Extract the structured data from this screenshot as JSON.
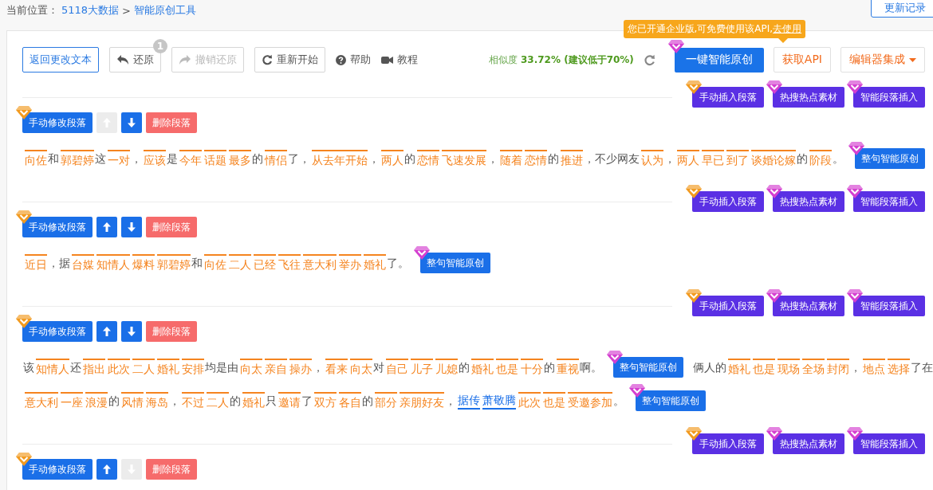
{
  "breadcrumb": {
    "label": "当前位置：",
    "links": [
      "5118大数据",
      "智能原创工具"
    ],
    "separator": ">"
  },
  "update_log_button": "更新记录",
  "toolbar": {
    "back_button": "返回更改文本",
    "undo": {
      "label": "还原",
      "badge": "1",
      "disabled": false
    },
    "redo": {
      "label": "撤销还原",
      "disabled": true
    },
    "restart": "重新开始",
    "help": "帮助",
    "tutorial": "教程",
    "similarity": {
      "label": "相似度",
      "value": "33.72% (建议低于70%)"
    },
    "rewrite_all": "一键智能原创",
    "get_api": "获取API",
    "editor_integration": "编辑器集成",
    "tooltip": {
      "text": "您已开通企业版,可免费使用该API,",
      "link": "去使用"
    }
  },
  "paragraphs": [
    {
      "insert_buttons": [
        {
          "label": "手动插入段落",
          "color": "#f29a1f"
        },
        {
          "label": "热搜热点素材",
          "color": "#d43fd0"
        },
        {
          "label": "智能段落插入",
          "color": "#d43fd0"
        }
      ],
      "edit_button": "手动修改段落",
      "move_up_disabled": true,
      "move_down_disabled": false,
      "delete_button": "删除段落",
      "lines": [
        [
          {
            "kind": "word",
            "text": "向佐"
          },
          {
            "kind": "plain",
            "text": "和"
          },
          {
            "kind": "word",
            "text": "郭碧婷"
          },
          {
            "kind": "plain",
            "text": "这"
          },
          {
            "kind": "word",
            "text": "一对"
          },
          {
            "kind": "plain",
            "text": "，"
          },
          {
            "kind": "word",
            "text": "应该"
          },
          {
            "kind": "plain",
            "text": "是"
          },
          {
            "kind": "word",
            "text": "今年"
          },
          {
            "kind": "word",
            "text": "话题"
          },
          {
            "kind": "word",
            "text": "最多"
          },
          {
            "kind": "plain",
            "text": "的"
          },
          {
            "kind": "word",
            "text": "情侣"
          },
          {
            "kind": "plain",
            "text": "了，"
          },
          {
            "kind": "word",
            "text": "从去年开始"
          },
          {
            "kind": "plain",
            "text": "，"
          },
          {
            "kind": "word",
            "text": "两人"
          },
          {
            "kind": "plain",
            "text": "的"
          },
          {
            "kind": "word",
            "text": "恋情"
          },
          {
            "kind": "word",
            "text": "飞速发展"
          },
          {
            "kind": "plain",
            "text": "，"
          },
          {
            "kind": "word",
            "text": "随着"
          },
          {
            "kind": "word",
            "text": "恋情"
          },
          {
            "kind": "plain",
            "text": "的"
          },
          {
            "kind": "word",
            "text": "推进"
          },
          {
            "kind": "plain",
            "text": "，不少网友"
          },
          {
            "kind": "word",
            "text": "认为"
          },
          {
            "kind": "plain",
            "text": "，"
          },
          {
            "kind": "word",
            "text": "两人"
          },
          {
            "kind": "word",
            "text": "早已"
          },
          {
            "kind": "word",
            "text": "到了"
          },
          {
            "kind": "word",
            "text": "谈婚论嫁"
          },
          {
            "kind": "plain",
            "text": "的"
          },
          {
            "kind": "word",
            "text": "阶段"
          },
          {
            "kind": "plain",
            "text": "。"
          },
          {
            "kind": "rewrite",
            "text": "整句智能原创"
          }
        ]
      ]
    },
    {
      "insert_buttons": [
        {
          "label": "手动插入段落",
          "color": "#f29a1f"
        },
        {
          "label": "热搜热点素材",
          "color": "#d43fd0"
        },
        {
          "label": "智能段落插入",
          "color": "#d43fd0"
        }
      ],
      "edit_button": "手动修改段落",
      "move_up_disabled": false,
      "move_down_disabled": false,
      "delete_button": "删除段落",
      "lines": [
        [
          {
            "kind": "word",
            "text": "近日"
          },
          {
            "kind": "plain",
            "text": "，据"
          },
          {
            "kind": "word",
            "text": "台媒"
          },
          {
            "kind": "word",
            "text": "知情人"
          },
          {
            "kind": "word",
            "text": "爆料"
          },
          {
            "kind": "word",
            "text": "郭碧婷"
          },
          {
            "kind": "plain",
            "text": "和"
          },
          {
            "kind": "word",
            "text": "向佐"
          },
          {
            "kind": "word",
            "text": "二人"
          },
          {
            "kind": "word",
            "text": "已经"
          },
          {
            "kind": "word",
            "text": "飞往"
          },
          {
            "kind": "word",
            "text": "意大利"
          },
          {
            "kind": "word",
            "text": "举办"
          },
          {
            "kind": "word",
            "text": "婚礼"
          },
          {
            "kind": "plain",
            "text": "了。"
          },
          {
            "kind": "rewrite",
            "text": "整句智能原创"
          }
        ]
      ]
    },
    {
      "insert_buttons": [
        {
          "label": "手动插入段落",
          "color": "#f29a1f"
        },
        {
          "label": "热搜热点素材",
          "color": "#d43fd0"
        },
        {
          "label": "智能段落插入",
          "color": "#d43fd0"
        }
      ],
      "edit_button": "手动修改段落",
      "move_up_disabled": false,
      "move_down_disabled": false,
      "delete_button": "删除段落",
      "lines": [
        [
          {
            "kind": "plain",
            "text": "该"
          },
          {
            "kind": "word",
            "text": "知情人"
          },
          {
            "kind": "plain",
            "text": "还"
          },
          {
            "kind": "word",
            "text": "指出"
          },
          {
            "kind": "word",
            "text": "此次"
          },
          {
            "kind": "word",
            "text": "二人"
          },
          {
            "kind": "word",
            "text": "婚礼"
          },
          {
            "kind": "word",
            "text": "安排"
          },
          {
            "kind": "plain",
            "text": "均是由"
          },
          {
            "kind": "word",
            "text": "向太"
          },
          {
            "kind": "word",
            "text": "亲自"
          },
          {
            "kind": "word",
            "text": "操办"
          },
          {
            "kind": "plain",
            "text": "，"
          },
          {
            "kind": "word",
            "text": "看来"
          },
          {
            "kind": "word",
            "text": "向太"
          },
          {
            "kind": "plain",
            "text": "对"
          },
          {
            "kind": "word",
            "text": "自己"
          },
          {
            "kind": "word",
            "text": "儿子"
          },
          {
            "kind": "word",
            "text": "儿媳"
          },
          {
            "kind": "plain",
            "text": "的"
          },
          {
            "kind": "word",
            "text": "婚礼"
          },
          {
            "kind": "word",
            "text": "也是"
          },
          {
            "kind": "word",
            "text": "十分"
          },
          {
            "kind": "plain",
            "text": "的"
          },
          {
            "kind": "word",
            "text": "重视"
          },
          {
            "kind": "plain",
            "text": "啊。"
          },
          {
            "kind": "rewrite",
            "text": "整句智能原创"
          },
          {
            "kind": "plain",
            "text": "俩人的"
          },
          {
            "kind": "word",
            "text": "婚礼"
          },
          {
            "kind": "word",
            "text": "也是"
          },
          {
            "kind": "word",
            "text": "现场"
          },
          {
            "kind": "word",
            "text": "全场"
          },
          {
            "kind": "word",
            "text": "封闭"
          },
          {
            "kind": "plain",
            "text": "，"
          },
          {
            "kind": "word",
            "text": "地点"
          },
          {
            "kind": "word",
            "text": "选择"
          },
          {
            "kind": "plain",
            "text": "了在"
          }
        ],
        [
          {
            "kind": "word",
            "text": "意大利"
          },
          {
            "kind": "word",
            "text": "一座"
          },
          {
            "kind": "word",
            "text": "浪漫"
          },
          {
            "kind": "plain",
            "text": "的"
          },
          {
            "kind": "word",
            "text": "风情"
          },
          {
            "kind": "word",
            "text": "海岛"
          },
          {
            "kind": "plain",
            "text": "，"
          },
          {
            "kind": "word",
            "text": "不过"
          },
          {
            "kind": "word",
            "text": "二人"
          },
          {
            "kind": "plain",
            "text": "的"
          },
          {
            "kind": "word",
            "text": "婚礼"
          },
          {
            "kind": "plain",
            "text": "只"
          },
          {
            "kind": "word",
            "text": "邀请"
          },
          {
            "kind": "plain",
            "text": "了"
          },
          {
            "kind": "word",
            "text": "双方"
          },
          {
            "kind": "word",
            "text": "各自"
          },
          {
            "kind": "plain",
            "text": "的"
          },
          {
            "kind": "word",
            "text": "部分"
          },
          {
            "kind": "word",
            "text": "亲朋好友"
          },
          {
            "kind": "plain",
            "text": "，"
          },
          {
            "kind": "link",
            "text": "据传"
          },
          {
            "kind": "link",
            "text": "萧敬腾"
          },
          {
            "kind": "word",
            "text": "此次"
          },
          {
            "kind": "word",
            "text": "也是"
          },
          {
            "kind": "word",
            "text": "受邀参加"
          },
          {
            "kind": "plain",
            "text": "。"
          },
          {
            "kind": "rewrite",
            "text": "整句智能原创"
          }
        ]
      ]
    },
    {
      "insert_buttons": [
        {
          "label": "手动插入段落",
          "color": "#f29a1f"
        },
        {
          "label": "热搜热点素材",
          "color": "#d43fd0"
        },
        {
          "label": "智能段落插入",
          "color": "#d43fd0"
        }
      ],
      "edit_button": "手动修改段落",
      "move_up_disabled": false,
      "move_down_disabled": true,
      "delete_button": "删除段落"
    }
  ]
}
